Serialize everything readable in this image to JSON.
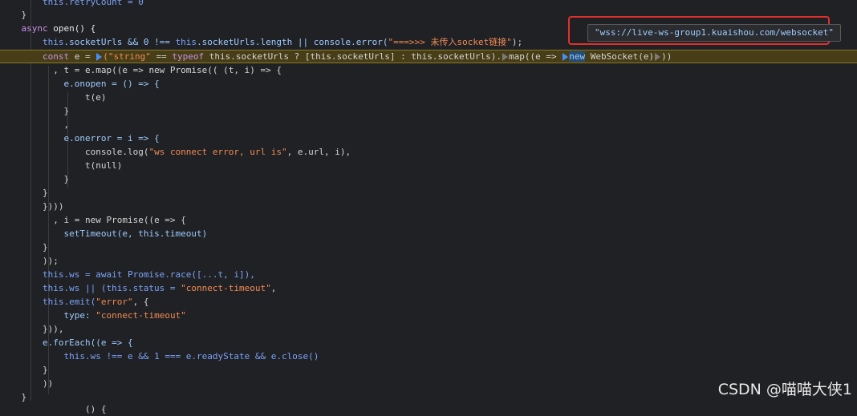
{
  "code": {
    "l0": "this.retryCount = 0",
    "l1": "}",
    "l2_kw": "async",
    "l2_rest": " open() {",
    "l3_this": "this",
    "l3_a": ".socketUrls && 0 !== ",
    "l3_b": ".socketUrls.length || console.error(",
    "l3_str": "\"===>>> 未传入socket链接\"",
    "l3_end": ");",
    "l4_const": "const",
    "l4_a": " e = ",
    "l4_str": "(\"string\"",
    "l4_b": " == ",
    "l4_typeof": "typeof",
    "l4_c": " this.socketUrls ? [this.socketUrls] : this.socketUrls).",
    "l4_map": "map((e => ",
    "l4_new": "new",
    "l4_d": " WebSocket(e)",
    "l4_e": "))",
    "l5": ", t = e.map((e => new Promise(( (t, i) => {",
    "l6": "e.onopen = () => {",
    "l7": "t(e)",
    "l8": "}",
    "l9": ",",
    "l10": "e.onerror = i => {",
    "l11_a": "console.log(",
    "l11_str": "\"ws connect error, url is\"",
    "l11_b": ", e.url, i),",
    "l12": "t(null)",
    "l13": "}",
    "l14": "}",
    "l15": "})))",
    "l16": ", i = new Promise((e => {",
    "l17": "setTimeout(e, this.timeout)",
    "l18": "}",
    "l19": "));",
    "l20": "this.ws = await Promise.race([...t, i]),",
    "l21_a": "this.ws || (this.status = ",
    "l21_str": "\"connect-timeout\"",
    "l21_b": ",",
    "l22_a": "this.emit(",
    "l22_str": "\"error\"",
    "l22_b": ", {",
    "l23_a": "type: ",
    "l23_str": "\"connect-timeout\"",
    "l24": "})),",
    "l25": "e.forEach((e => {",
    "l26": "this.ws !== e && 1 === e.readyState && e.close()",
    "l27": "}",
    "l28": "))",
    "l29": "}",
    "l30": "() {"
  },
  "tooltip": {
    "value": "\"wss://live-ws-group1.kuaishou.com/websocket\""
  },
  "watermark": {
    "text": "CSDN @喵喵大侠1"
  },
  "colors": {
    "background": "#202124",
    "highlight_line": "#473d16",
    "annotation_box": "#e0302b",
    "string": "#f28b54",
    "keyword": "#c792ea",
    "this_keyword": "#7aa2f7"
  },
  "icons": {
    "breakpoint": "breakpoint-marker-icon"
  }
}
